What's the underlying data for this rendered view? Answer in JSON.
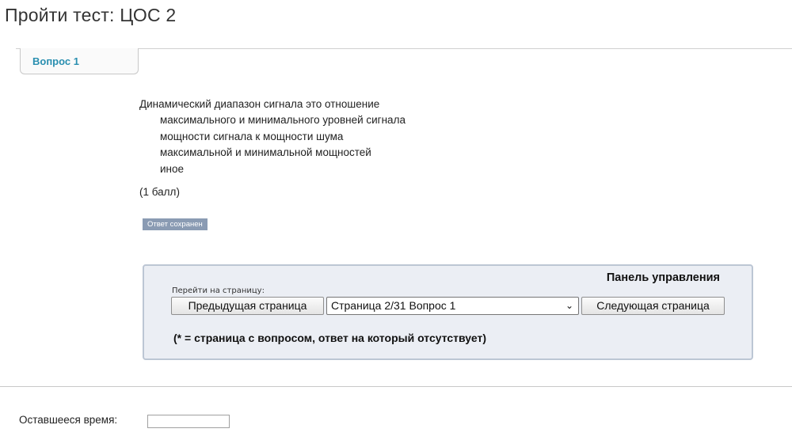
{
  "page": {
    "title": "Пройти тест:  ЦОС 2"
  },
  "question": {
    "tab_label": "Вопрос 1",
    "text": "Динамический диапазон сигнала это отношение",
    "options": [
      "максимального и минимального уровней сигнала",
      "мощности сигнала к мощности шума",
      "максимальной и минимальной мощностей",
      "иное"
    ],
    "points": "(1 балл)",
    "saved_badge": "Ответ сохранен"
  },
  "nav_panel": {
    "heading": "Панель управления",
    "goto_label": "Перейти на страницу:",
    "prev_button": "Предыдущая страница",
    "page_select_value": "Страница 2/31 Вопрос 1",
    "next_button": "Следующая страница",
    "legend": "(* = страница с вопросом, ответ на который отсутствует)"
  },
  "footer": {
    "time_label": "Оставшееся время:",
    "time_value": ""
  }
}
